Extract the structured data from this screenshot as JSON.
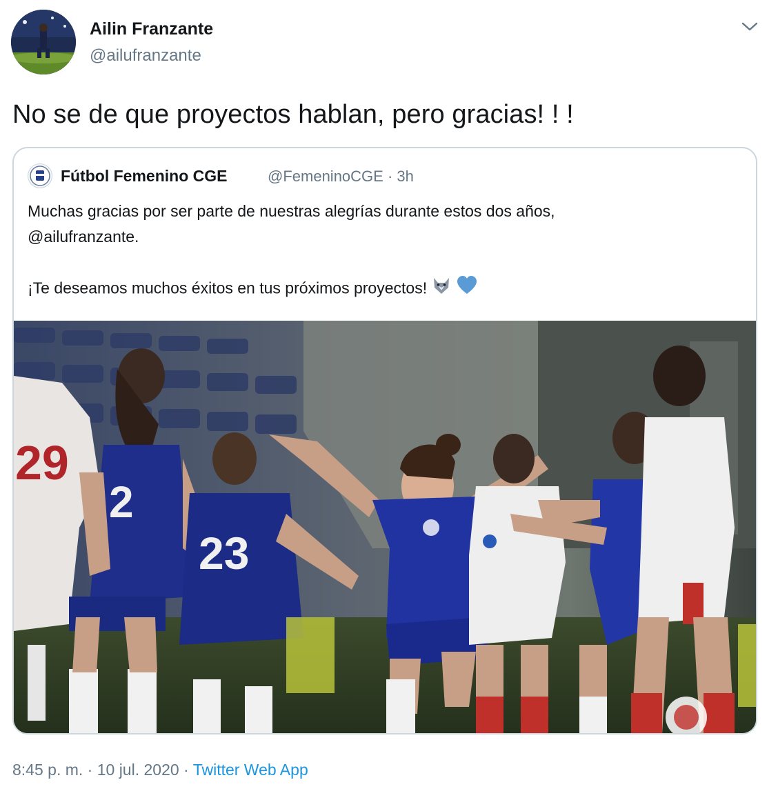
{
  "tweet": {
    "author_name": "Ailin Franzante",
    "author_handle": "@ailufranzante",
    "text": "No se de que proyectos hablan, pero gracias! ! !",
    "timestamp": "8:45 p. m. · 10 jul. 2020",
    "separator": " · ",
    "source": "Twitter Web App",
    "menu_icon": "chevron-down-icon"
  },
  "quote": {
    "author_name": "Fútbol Femenino CGE",
    "author_handle_time": "@FemeninoCGE · 3h",
    "line1": "Muchas gracias por ser parte de nuestras alegrías durante estos dos años,",
    "line2": "@ailufranzante.",
    "line3": "¡Te deseamos muchos éxitos en tus próximos proyectos!",
    "emojis": [
      "wolf-emoji",
      "blue-heart-emoji"
    ],
    "accent": "#5b9bd5"
  },
  "colors": {
    "text": "#14171a",
    "secondary": "#657786",
    "link": "#1b95e0",
    "border": "#ccd6dd"
  }
}
